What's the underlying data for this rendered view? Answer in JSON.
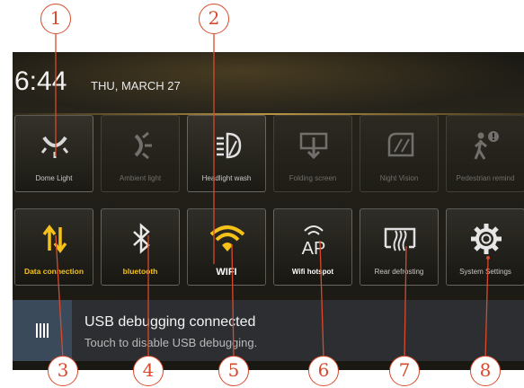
{
  "status": {
    "time": "6:44",
    "date": "THU, MARCH 27"
  },
  "tiles_row1": [
    {
      "label": "Dome Light",
      "icon": "dome-light-icon",
      "state": "normal"
    },
    {
      "label": "Ambient light",
      "icon": "ambient-light-icon",
      "state": "dim"
    },
    {
      "label": "Headlight wash",
      "icon": "headlight-wash-icon",
      "state": "normal"
    },
    {
      "label": "Folding screen",
      "icon": "folding-screen-icon",
      "state": "dim"
    },
    {
      "label": "Night Vision",
      "icon": "night-vision-icon",
      "state": "dim"
    },
    {
      "label": "Pedestrian remind",
      "icon": "pedestrian-remind-icon",
      "state": "dim"
    }
  ],
  "tiles_row2": [
    {
      "label": "Data connection",
      "icon": "data-connection-icon",
      "state": "on"
    },
    {
      "label": "bluetooth",
      "icon": "bluetooth-icon",
      "state": "on"
    },
    {
      "label": "WIFI",
      "icon": "wifi-icon",
      "state": "on"
    },
    {
      "label": "Wifi hotspot",
      "icon": "wifi-hotspot-icon",
      "state": "normal"
    },
    {
      "label": "Rear defrosting",
      "icon": "rear-defrost-icon",
      "state": "normal"
    },
    {
      "label": "System Settings",
      "icon": "gear-icon",
      "state": "normal"
    }
  ],
  "notification": {
    "title": "USB debugging connected",
    "subtitle": "Touch to disable USB debugging.",
    "icon": "usb-icon"
  },
  "callouts": [
    "1",
    "2",
    "3",
    "4",
    "5",
    "6",
    "7",
    "8"
  ],
  "colors": {
    "accent": "#f5c21a",
    "callout": "#d84a2c",
    "panel": "#221f18",
    "notification": "#2c2e31"
  }
}
